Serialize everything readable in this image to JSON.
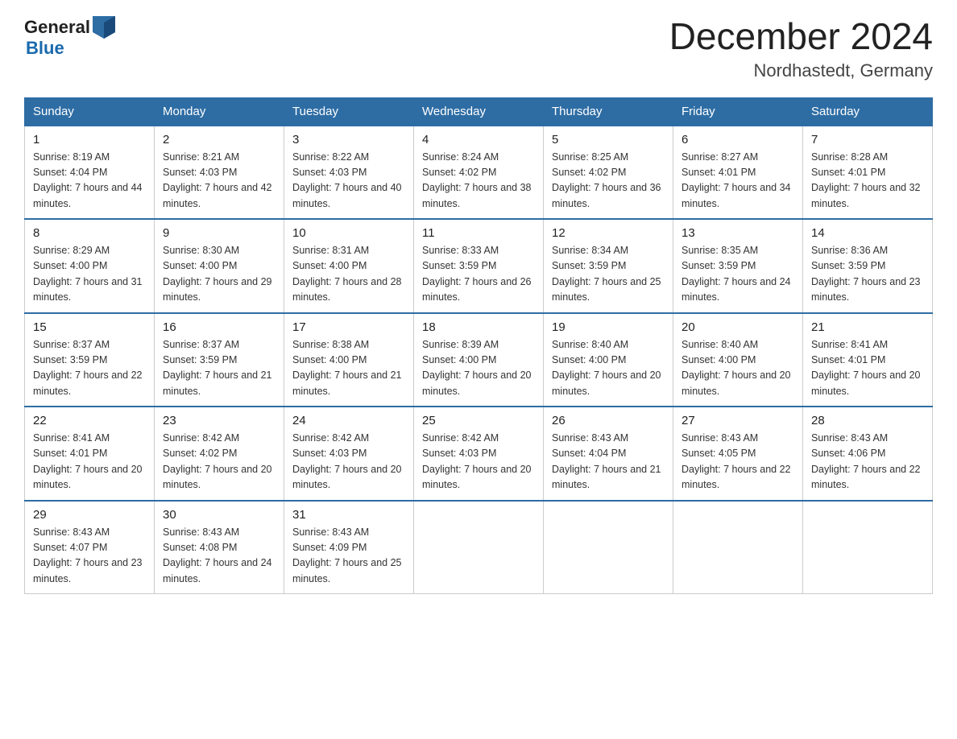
{
  "header": {
    "logo_general": "General",
    "logo_blue": "Blue",
    "title": "December 2024",
    "subtitle": "Nordhastedt, Germany"
  },
  "days_of_week": [
    "Sunday",
    "Monday",
    "Tuesday",
    "Wednesday",
    "Thursday",
    "Friday",
    "Saturday"
  ],
  "weeks": [
    [
      {
        "day": "1",
        "sunrise": "Sunrise: 8:19 AM",
        "sunset": "Sunset: 4:04 PM",
        "daylight": "Daylight: 7 hours and 44 minutes."
      },
      {
        "day": "2",
        "sunrise": "Sunrise: 8:21 AM",
        "sunset": "Sunset: 4:03 PM",
        "daylight": "Daylight: 7 hours and 42 minutes."
      },
      {
        "day": "3",
        "sunrise": "Sunrise: 8:22 AM",
        "sunset": "Sunset: 4:03 PM",
        "daylight": "Daylight: 7 hours and 40 minutes."
      },
      {
        "day": "4",
        "sunrise": "Sunrise: 8:24 AM",
        "sunset": "Sunset: 4:02 PM",
        "daylight": "Daylight: 7 hours and 38 minutes."
      },
      {
        "day": "5",
        "sunrise": "Sunrise: 8:25 AM",
        "sunset": "Sunset: 4:02 PM",
        "daylight": "Daylight: 7 hours and 36 minutes."
      },
      {
        "day": "6",
        "sunrise": "Sunrise: 8:27 AM",
        "sunset": "Sunset: 4:01 PM",
        "daylight": "Daylight: 7 hours and 34 minutes."
      },
      {
        "day": "7",
        "sunrise": "Sunrise: 8:28 AM",
        "sunset": "Sunset: 4:01 PM",
        "daylight": "Daylight: 7 hours and 32 minutes."
      }
    ],
    [
      {
        "day": "8",
        "sunrise": "Sunrise: 8:29 AM",
        "sunset": "Sunset: 4:00 PM",
        "daylight": "Daylight: 7 hours and 31 minutes."
      },
      {
        "day": "9",
        "sunrise": "Sunrise: 8:30 AM",
        "sunset": "Sunset: 4:00 PM",
        "daylight": "Daylight: 7 hours and 29 minutes."
      },
      {
        "day": "10",
        "sunrise": "Sunrise: 8:31 AM",
        "sunset": "Sunset: 4:00 PM",
        "daylight": "Daylight: 7 hours and 28 minutes."
      },
      {
        "day": "11",
        "sunrise": "Sunrise: 8:33 AM",
        "sunset": "Sunset: 3:59 PM",
        "daylight": "Daylight: 7 hours and 26 minutes."
      },
      {
        "day": "12",
        "sunrise": "Sunrise: 8:34 AM",
        "sunset": "Sunset: 3:59 PM",
        "daylight": "Daylight: 7 hours and 25 minutes."
      },
      {
        "day": "13",
        "sunrise": "Sunrise: 8:35 AM",
        "sunset": "Sunset: 3:59 PM",
        "daylight": "Daylight: 7 hours and 24 minutes."
      },
      {
        "day": "14",
        "sunrise": "Sunrise: 8:36 AM",
        "sunset": "Sunset: 3:59 PM",
        "daylight": "Daylight: 7 hours and 23 minutes."
      }
    ],
    [
      {
        "day": "15",
        "sunrise": "Sunrise: 8:37 AM",
        "sunset": "Sunset: 3:59 PM",
        "daylight": "Daylight: 7 hours and 22 minutes."
      },
      {
        "day": "16",
        "sunrise": "Sunrise: 8:37 AM",
        "sunset": "Sunset: 3:59 PM",
        "daylight": "Daylight: 7 hours and 21 minutes."
      },
      {
        "day": "17",
        "sunrise": "Sunrise: 8:38 AM",
        "sunset": "Sunset: 4:00 PM",
        "daylight": "Daylight: 7 hours and 21 minutes."
      },
      {
        "day": "18",
        "sunrise": "Sunrise: 8:39 AM",
        "sunset": "Sunset: 4:00 PM",
        "daylight": "Daylight: 7 hours and 20 minutes."
      },
      {
        "day": "19",
        "sunrise": "Sunrise: 8:40 AM",
        "sunset": "Sunset: 4:00 PM",
        "daylight": "Daylight: 7 hours and 20 minutes."
      },
      {
        "day": "20",
        "sunrise": "Sunrise: 8:40 AM",
        "sunset": "Sunset: 4:00 PM",
        "daylight": "Daylight: 7 hours and 20 minutes."
      },
      {
        "day": "21",
        "sunrise": "Sunrise: 8:41 AM",
        "sunset": "Sunset: 4:01 PM",
        "daylight": "Daylight: 7 hours and 20 minutes."
      }
    ],
    [
      {
        "day": "22",
        "sunrise": "Sunrise: 8:41 AM",
        "sunset": "Sunset: 4:01 PM",
        "daylight": "Daylight: 7 hours and 20 minutes."
      },
      {
        "day": "23",
        "sunrise": "Sunrise: 8:42 AM",
        "sunset": "Sunset: 4:02 PM",
        "daylight": "Daylight: 7 hours and 20 minutes."
      },
      {
        "day": "24",
        "sunrise": "Sunrise: 8:42 AM",
        "sunset": "Sunset: 4:03 PM",
        "daylight": "Daylight: 7 hours and 20 minutes."
      },
      {
        "day": "25",
        "sunrise": "Sunrise: 8:42 AM",
        "sunset": "Sunset: 4:03 PM",
        "daylight": "Daylight: 7 hours and 20 minutes."
      },
      {
        "day": "26",
        "sunrise": "Sunrise: 8:43 AM",
        "sunset": "Sunset: 4:04 PM",
        "daylight": "Daylight: 7 hours and 21 minutes."
      },
      {
        "day": "27",
        "sunrise": "Sunrise: 8:43 AM",
        "sunset": "Sunset: 4:05 PM",
        "daylight": "Daylight: 7 hours and 22 minutes."
      },
      {
        "day": "28",
        "sunrise": "Sunrise: 8:43 AM",
        "sunset": "Sunset: 4:06 PM",
        "daylight": "Daylight: 7 hours and 22 minutes."
      }
    ],
    [
      {
        "day": "29",
        "sunrise": "Sunrise: 8:43 AM",
        "sunset": "Sunset: 4:07 PM",
        "daylight": "Daylight: 7 hours and 23 minutes."
      },
      {
        "day": "30",
        "sunrise": "Sunrise: 8:43 AM",
        "sunset": "Sunset: 4:08 PM",
        "daylight": "Daylight: 7 hours and 24 minutes."
      },
      {
        "day": "31",
        "sunrise": "Sunrise: 8:43 AM",
        "sunset": "Sunset: 4:09 PM",
        "daylight": "Daylight: 7 hours and 25 minutes."
      },
      null,
      null,
      null,
      null
    ]
  ]
}
